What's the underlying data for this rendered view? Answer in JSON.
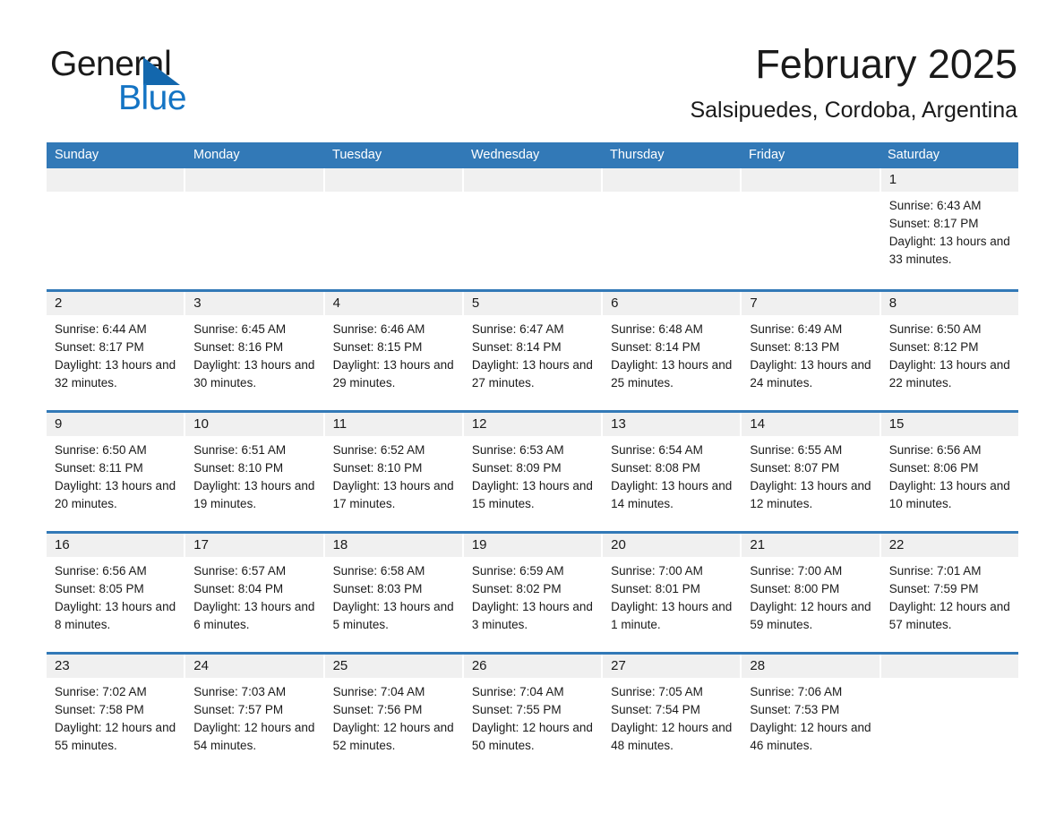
{
  "brand": {
    "name_top": "General",
    "name_bottom": "Blue",
    "triangle_icon": "triangle-icon",
    "color_black": "#1a1a1a",
    "color_blue": "#1474c4"
  },
  "header": {
    "title": "February 2025",
    "subtitle": "Salsipuedes, Cordoba, Argentina"
  },
  "theme": {
    "header_blue": "#3279b7",
    "daynum_band": "#f0f0f0",
    "text": "#1a1a1a",
    "page_bg": "#ffffff"
  },
  "calendar": {
    "weekday_headers": [
      "Sunday",
      "Monday",
      "Tuesday",
      "Wednesday",
      "Thursday",
      "Friday",
      "Saturday"
    ],
    "weeks": [
      [
        {
          "day": "",
          "sunrise": "",
          "sunset": "",
          "daylight": "",
          "empty": true
        },
        {
          "day": "",
          "sunrise": "",
          "sunset": "",
          "daylight": "",
          "empty": true
        },
        {
          "day": "",
          "sunrise": "",
          "sunset": "",
          "daylight": "",
          "empty": true
        },
        {
          "day": "",
          "sunrise": "",
          "sunset": "",
          "daylight": "",
          "empty": true
        },
        {
          "day": "",
          "sunrise": "",
          "sunset": "",
          "daylight": "",
          "empty": true
        },
        {
          "day": "",
          "sunrise": "",
          "sunset": "",
          "daylight": "",
          "empty": true
        },
        {
          "day": "1",
          "sunrise": "Sunrise: 6:43 AM",
          "sunset": "Sunset: 8:17 PM",
          "daylight": "Daylight: 13 hours and 33 minutes.",
          "empty": false
        }
      ],
      [
        {
          "day": "2",
          "sunrise": "Sunrise: 6:44 AM",
          "sunset": "Sunset: 8:17 PM",
          "daylight": "Daylight: 13 hours and 32 minutes.",
          "empty": false
        },
        {
          "day": "3",
          "sunrise": "Sunrise: 6:45 AM",
          "sunset": "Sunset: 8:16 PM",
          "daylight": "Daylight: 13 hours and 30 minutes.",
          "empty": false
        },
        {
          "day": "4",
          "sunrise": "Sunrise: 6:46 AM",
          "sunset": "Sunset: 8:15 PM",
          "daylight": "Daylight: 13 hours and 29 minutes.",
          "empty": false
        },
        {
          "day": "5",
          "sunrise": "Sunrise: 6:47 AM",
          "sunset": "Sunset: 8:14 PM",
          "daylight": "Daylight: 13 hours and 27 minutes.",
          "empty": false
        },
        {
          "day": "6",
          "sunrise": "Sunrise: 6:48 AM",
          "sunset": "Sunset: 8:14 PM",
          "daylight": "Daylight: 13 hours and 25 minutes.",
          "empty": false
        },
        {
          "day": "7",
          "sunrise": "Sunrise: 6:49 AM",
          "sunset": "Sunset: 8:13 PM",
          "daylight": "Daylight: 13 hours and 24 minutes.",
          "empty": false
        },
        {
          "day": "8",
          "sunrise": "Sunrise: 6:50 AM",
          "sunset": "Sunset: 8:12 PM",
          "daylight": "Daylight: 13 hours and 22 minutes.",
          "empty": false
        }
      ],
      [
        {
          "day": "9",
          "sunrise": "Sunrise: 6:50 AM",
          "sunset": "Sunset: 8:11 PM",
          "daylight": "Daylight: 13 hours and 20 minutes.",
          "empty": false
        },
        {
          "day": "10",
          "sunrise": "Sunrise: 6:51 AM",
          "sunset": "Sunset: 8:10 PM",
          "daylight": "Daylight: 13 hours and 19 minutes.",
          "empty": false
        },
        {
          "day": "11",
          "sunrise": "Sunrise: 6:52 AM",
          "sunset": "Sunset: 8:10 PM",
          "daylight": "Daylight: 13 hours and 17 minutes.",
          "empty": false
        },
        {
          "day": "12",
          "sunrise": "Sunrise: 6:53 AM",
          "sunset": "Sunset: 8:09 PM",
          "daylight": "Daylight: 13 hours and 15 minutes.",
          "empty": false
        },
        {
          "day": "13",
          "sunrise": "Sunrise: 6:54 AM",
          "sunset": "Sunset: 8:08 PM",
          "daylight": "Daylight: 13 hours and 14 minutes.",
          "empty": false
        },
        {
          "day": "14",
          "sunrise": "Sunrise: 6:55 AM",
          "sunset": "Sunset: 8:07 PM",
          "daylight": "Daylight: 13 hours and 12 minutes.",
          "empty": false
        },
        {
          "day": "15",
          "sunrise": "Sunrise: 6:56 AM",
          "sunset": "Sunset: 8:06 PM",
          "daylight": "Daylight: 13 hours and 10 minutes.",
          "empty": false
        }
      ],
      [
        {
          "day": "16",
          "sunrise": "Sunrise: 6:56 AM",
          "sunset": "Sunset: 8:05 PM",
          "daylight": "Daylight: 13 hours and 8 minutes.",
          "empty": false
        },
        {
          "day": "17",
          "sunrise": "Sunrise: 6:57 AM",
          "sunset": "Sunset: 8:04 PM",
          "daylight": "Daylight: 13 hours and 6 minutes.",
          "empty": false
        },
        {
          "day": "18",
          "sunrise": "Sunrise: 6:58 AM",
          "sunset": "Sunset: 8:03 PM",
          "daylight": "Daylight: 13 hours and 5 minutes.",
          "empty": false
        },
        {
          "day": "19",
          "sunrise": "Sunrise: 6:59 AM",
          "sunset": "Sunset: 8:02 PM",
          "daylight": "Daylight: 13 hours and 3 minutes.",
          "empty": false
        },
        {
          "day": "20",
          "sunrise": "Sunrise: 7:00 AM",
          "sunset": "Sunset: 8:01 PM",
          "daylight": "Daylight: 13 hours and 1 minute.",
          "empty": false
        },
        {
          "day": "21",
          "sunrise": "Sunrise: 7:00 AM",
          "sunset": "Sunset: 8:00 PM",
          "daylight": "Daylight: 12 hours and 59 minutes.",
          "empty": false
        },
        {
          "day": "22",
          "sunrise": "Sunrise: 7:01 AM",
          "sunset": "Sunset: 7:59 PM",
          "daylight": "Daylight: 12 hours and 57 minutes.",
          "empty": false
        }
      ],
      [
        {
          "day": "23",
          "sunrise": "Sunrise: 7:02 AM",
          "sunset": "Sunset: 7:58 PM",
          "daylight": "Daylight: 12 hours and 55 minutes.",
          "empty": false
        },
        {
          "day": "24",
          "sunrise": "Sunrise: 7:03 AM",
          "sunset": "Sunset: 7:57 PM",
          "daylight": "Daylight: 12 hours and 54 minutes.",
          "empty": false
        },
        {
          "day": "25",
          "sunrise": "Sunrise: 7:04 AM",
          "sunset": "Sunset: 7:56 PM",
          "daylight": "Daylight: 12 hours and 52 minutes.",
          "empty": false
        },
        {
          "day": "26",
          "sunrise": "Sunrise: 7:04 AM",
          "sunset": "Sunset: 7:55 PM",
          "daylight": "Daylight: 12 hours and 50 minutes.",
          "empty": false
        },
        {
          "day": "27",
          "sunrise": "Sunrise: 7:05 AM",
          "sunset": "Sunset: 7:54 PM",
          "daylight": "Daylight: 12 hours and 48 minutes.",
          "empty": false
        },
        {
          "day": "28",
          "sunrise": "Sunrise: 7:06 AM",
          "sunset": "Sunset: 7:53 PM",
          "daylight": "Daylight: 12 hours and 46 minutes.",
          "empty": false
        },
        {
          "day": "",
          "sunrise": "",
          "sunset": "",
          "daylight": "",
          "empty": true
        }
      ]
    ]
  }
}
